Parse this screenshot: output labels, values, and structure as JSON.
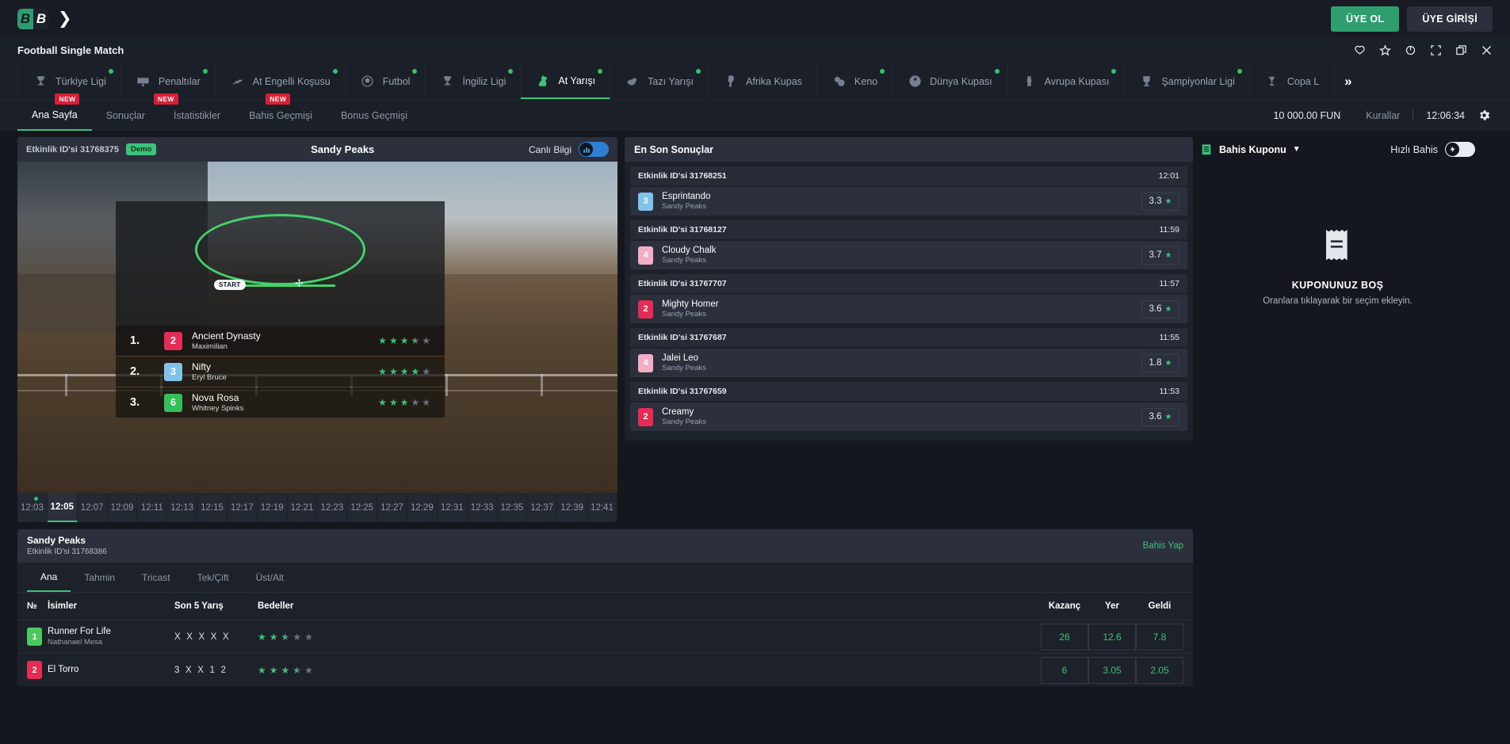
{
  "brand": {
    "logo_left": "B",
    "logo_right": "B",
    "signup": "ÜYE OL",
    "login": "ÜYE GİRİŞİ"
  },
  "window": {
    "title": "Football Single Match"
  },
  "window_icons": [
    "heart-icon",
    "star-icon",
    "refresh-icon",
    "fullscreen-icon",
    "window-icon",
    "close-icon"
  ],
  "game_tabs": [
    {
      "label": "Türkiye Ligi",
      "icon": "trophy-icon",
      "dot": true,
      "new": true,
      "active": false
    },
    {
      "label": "Penaltılar",
      "icon": "goal-icon",
      "dot": true,
      "new": true,
      "active": false
    },
    {
      "label": "At Engelli Koşusu",
      "icon": "jump-icon",
      "dot": true,
      "new": true,
      "active": false
    },
    {
      "label": "Futbol",
      "icon": "football-icon",
      "dot": true,
      "new": false,
      "active": false
    },
    {
      "label": "İngiliz Ligi",
      "icon": "trophy-icon",
      "dot": true,
      "new": false,
      "active": false
    },
    {
      "label": "At Yarışı",
      "icon": "horse-icon",
      "dot": true,
      "new": false,
      "active": true
    },
    {
      "label": "Tazı Yarışı",
      "icon": "dog-icon",
      "dot": true,
      "new": false,
      "active": false
    },
    {
      "label": "Afrika Kupas",
      "icon": "africa-icon",
      "dot": false,
      "new": false,
      "active": false
    },
    {
      "label": "Keno",
      "icon": "keno-icon",
      "dot": true,
      "new": false,
      "active": false
    },
    {
      "label": "Dünya Kupası",
      "icon": "globe-icon",
      "dot": true,
      "new": false,
      "active": false
    },
    {
      "label": "Avrupa Kupası",
      "icon": "cup-icon",
      "dot": true,
      "new": false,
      "active": false
    },
    {
      "label": "Şampiyonlar Ligi",
      "icon": "ucl-icon",
      "dot": true,
      "new": false,
      "active": false
    },
    {
      "label": "Copa L",
      "icon": "copa-icon",
      "dot": false,
      "new": false,
      "active": false
    }
  ],
  "game_tabs_more": "»",
  "subnav": {
    "items": [
      {
        "label": "Ana Sayfa",
        "active": true
      },
      {
        "label": "Sonuçlar",
        "active": false
      },
      {
        "label": "İstatistikler",
        "active": false
      },
      {
        "label": "Bahis Geçmişi",
        "active": false
      },
      {
        "label": "Bonus Geçmişi",
        "active": false
      }
    ],
    "balance": "10 000.00 FUN",
    "rules": "Kurallar",
    "clock": "12:06:34",
    "settings_icon": "gear-icon"
  },
  "match": {
    "event_id_label": "Etkinlik ID'si 31768375",
    "demo_badge": "Demo",
    "title": "Sandy Peaks",
    "live_info_label": "Canlı Bilgi",
    "live_info_on": true,
    "track_start_label": "START"
  },
  "leaderboard": [
    {
      "pos": "1.",
      "num": "2",
      "color": "#e62c55",
      "horse": "Ancient Dynasty",
      "jockey": "Maximilian",
      "stars": 3.5
    },
    {
      "pos": "2.",
      "num": "3",
      "color": "#7fc3ea",
      "horse": "Nifty",
      "jockey": "Eryl Bruce",
      "stars": 4
    },
    {
      "pos": "3.",
      "num": "6",
      "color": "#32c05a",
      "horse": "Nova Rosa",
      "jockey": "Whitney Spinks",
      "stars": 3
    }
  ],
  "timeline": {
    "items": [
      "12:03",
      "12:05",
      "12:07",
      "12:09",
      "12:11",
      "12:13",
      "12:15",
      "12:17",
      "12:19",
      "12:21",
      "12:23",
      "12:25",
      "12:27",
      "12:29",
      "12:31",
      "12:33",
      "12:35",
      "12:37",
      "12:39",
      "12:41"
    ],
    "active_index": 1,
    "dot_index": 0
  },
  "results": {
    "title": "En Son Sonuçlar",
    "groups": [
      {
        "event_id": "Etkinlik ID'si 31768251",
        "time": "12:01",
        "num": "3",
        "color": "#7fc3ea",
        "horse": "Esprintando",
        "track": "Sandy Peaks",
        "odd": "3.3"
      },
      {
        "event_id": "Etkinlik ID'si 31768127",
        "time": "11:59",
        "num": "4",
        "color": "#f3aec6",
        "horse": "Cloudy Chalk",
        "track": "Sandy Peaks",
        "odd": "3.7"
      },
      {
        "event_id": "Etkinlik ID'si 31767707",
        "time": "11:57",
        "num": "2",
        "color": "#e62c55",
        "horse": "Mighty Homer",
        "track": "Sandy Peaks",
        "odd": "3.6"
      },
      {
        "event_id": "Etkinlik ID'si 31767687",
        "time": "11:55",
        "num": "4",
        "color": "#f3aec6",
        "horse": "Jalei Leo",
        "track": "Sandy Peaks",
        "odd": "1.8"
      },
      {
        "event_id": "Etkinlik ID'si 31767659",
        "time": "11:53",
        "num": "2",
        "color": "#e62c55",
        "horse": "Creamy",
        "track": "Sandy Peaks",
        "odd": "3.6"
      }
    ]
  },
  "bottom_card": {
    "title": "Sandy Peaks",
    "subtitle": "Etkinlik ID'si 31768386",
    "bet_link": "Bahis Yap",
    "tabs": [
      {
        "label": "Ana",
        "active": true
      },
      {
        "label": "Tahmin",
        "active": false
      },
      {
        "label": "Tricast",
        "active": false
      },
      {
        "label": "Tek/Çift",
        "active": false
      },
      {
        "label": "Üst/Alt",
        "active": false
      }
    ],
    "columns": {
      "no": "№",
      "names": "İsimler",
      "last5": "Son 5 Yarış",
      "prices": "Bedeller",
      "win": "Kazanç",
      "place": "Yer",
      "show": "Geldi"
    },
    "rows": [
      {
        "num": "1",
        "color": "#4bc85e",
        "horse": "Runner For Life",
        "jockey": "Nathanael Mesa",
        "last5": "X X X X X",
        "stars": 2.5,
        "win": "26",
        "place": "12.6",
        "show": "7.8"
      },
      {
        "num": "2",
        "color": "#e62c55",
        "horse": "El Torro",
        "jockey": "",
        "last5": "3 X X 1 2",
        "stars": 3.5,
        "win": "6",
        "place": "3.05",
        "show": "2.05"
      }
    ]
  },
  "betslip": {
    "icon": "receipt-icon",
    "title": "Bahis Kuponu",
    "chevron": "chevron-down-icon",
    "quick_bet_label": "Hızlı Bahis",
    "quick_bet_on": false,
    "empty_title": "KUPONUNUZ BOŞ",
    "empty_subtitle": "Oranlara tıklayarak bir seçim ekleyin."
  },
  "colors": {
    "accent": "#3ec17a",
    "bg": "#15171f",
    "panel": "#1d212a",
    "panel2": "#2b303c",
    "danger": "#d81f36"
  }
}
